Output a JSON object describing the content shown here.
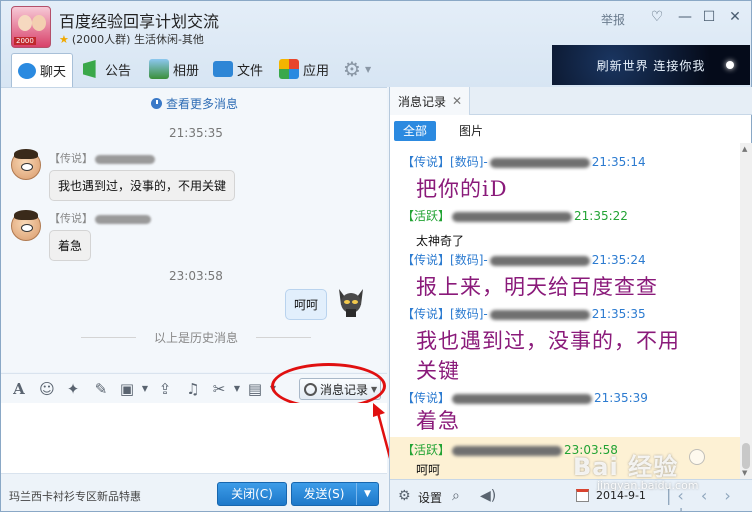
{
  "window": {
    "title": "百度经验回享计划交流",
    "subtitle": "(2000人群) 生活休闲-其他",
    "avatar_tag": "2000",
    "report_label": "举报",
    "ad_text": "刷新世界 连接你我"
  },
  "toolbar": {
    "items": [
      {
        "label": "聊天",
        "icon": "chat-icon"
      },
      {
        "label": "公告",
        "icon": "announcement-icon"
      },
      {
        "label": "相册",
        "icon": "photo-album-icon"
      },
      {
        "label": "文件",
        "icon": "folder-icon"
      },
      {
        "label": "应用",
        "icon": "apps-icon"
      }
    ]
  },
  "chat": {
    "more_messages": "查看更多消息",
    "messages": [
      {
        "time": "21:35:35",
        "sender_tag": "【传说】",
        "text": "我也遇到过，没事的，不用关键"
      },
      {
        "sender_tag": "【传说】",
        "text": "着急"
      },
      {
        "time": "23:03:58",
        "text": "呵呵",
        "self": true
      }
    ],
    "history_divider": "以上是历史消息"
  },
  "input_toolbar": {
    "history_button": "消息记录"
  },
  "bottom": {
    "promo": "玛兰西卡衬衫专区新品特惠",
    "close_label": "关闭(C)",
    "send_label": "发送(S)"
  },
  "history_panel": {
    "tab_label": "消息记录",
    "filters": [
      "全部",
      "图片"
    ],
    "entries": [
      {
        "tag": "【传说】",
        "tag2": "[数码]-",
        "time": "21:35:14",
        "text": "把你的iD",
        "style": "big"
      },
      {
        "tag": "【活跃】",
        "time": "21:35:22",
        "text": "太神奇了",
        "style": "small"
      },
      {
        "tag": "【传说】",
        "tag2": "[数码]-",
        "time": "21:35:24",
        "text": "报上来，明天给百度查查",
        "style": "big"
      },
      {
        "tag": "【传说】",
        "tag2": "[数码]-",
        "time": "21:35:35",
        "text": "我也遇到过，没事的，不用",
        "text2": "关键",
        "style": "big"
      },
      {
        "tag": "【传说】",
        "time": "21:35:39",
        "text": "着急",
        "style": "big"
      },
      {
        "tag": "【活跃】",
        "time": "23:03:58",
        "text": "呵呵",
        "style": "small"
      }
    ],
    "settings_label": "设置",
    "date": "2014-9-1"
  },
  "watermark": {
    "logo": "Bai 经验",
    "url": "jingyan.baidu.com"
  },
  "colors": {
    "accent": "#2c8ae0",
    "big_text": "#8a1a7a",
    "tag_blue": "#2c7bd0",
    "tag_green": "#22a334",
    "highlight_red": "#e01010"
  }
}
